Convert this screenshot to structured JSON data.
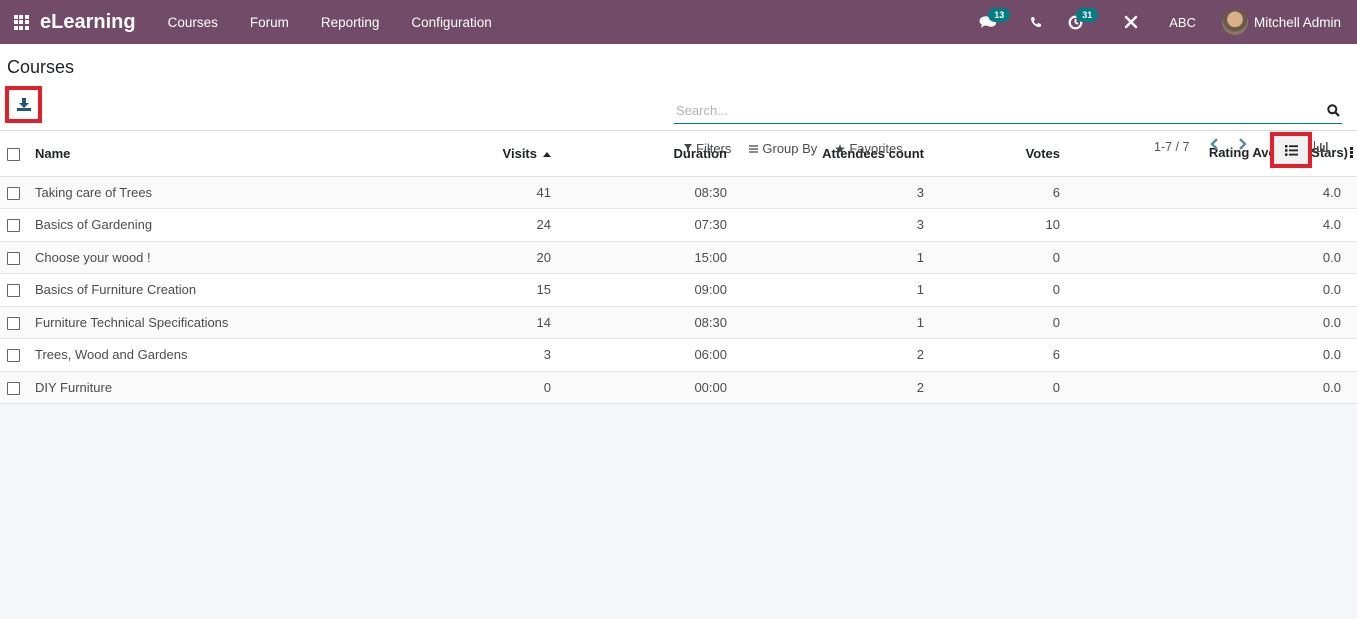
{
  "navbar": {
    "app_name": "eLearning",
    "menu": [
      "Courses",
      "Forum",
      "Reporting",
      "Configuration"
    ],
    "messages_badge": "13",
    "activities_badge": "31",
    "company": "ABC",
    "user": "Mitchell Admin",
    "brand_color": "#714b67"
  },
  "control_panel": {
    "title": "Courses",
    "search_placeholder": "Search...",
    "filters_label": "Filters",
    "group_by_label": "Group By",
    "favorites_label": "Favorites",
    "pager": "1-7 / 7"
  },
  "table": {
    "columns": [
      "Name",
      "Visits",
      "Duration",
      "Attendees count",
      "Votes",
      "Rating Average (Stars)"
    ],
    "sorted_column": "Visits",
    "sort_direction": "ascending",
    "rows": [
      {
        "name": "Taking care of Trees",
        "visits": "41",
        "duration": "08:30",
        "attendees": "3",
        "votes": "6",
        "rating": "4.0"
      },
      {
        "name": "Basics of Gardening",
        "visits": "24",
        "duration": "07:30",
        "attendees": "3",
        "votes": "10",
        "rating": "4.0"
      },
      {
        "name": "Choose your wood !",
        "visits": "20",
        "duration": "15:00",
        "attendees": "1",
        "votes": "0",
        "rating": "0.0"
      },
      {
        "name": "Basics of Furniture Creation",
        "visits": "15",
        "duration": "09:00",
        "attendees": "1",
        "votes": "0",
        "rating": "0.0"
      },
      {
        "name": "Furniture Technical Specifications",
        "visits": "14",
        "duration": "08:30",
        "attendees": "1",
        "votes": "0",
        "rating": "0.0"
      },
      {
        "name": "Trees, Wood and Gardens",
        "visits": "3",
        "duration": "06:00",
        "attendees": "2",
        "votes": "6",
        "rating": "0.0"
      },
      {
        "name": "DIY Furniture",
        "visits": "0",
        "duration": "00:00",
        "attendees": "2",
        "votes": "0",
        "rating": "0.0"
      }
    ]
  }
}
